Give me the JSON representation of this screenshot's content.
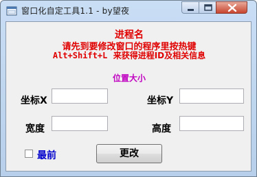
{
  "window": {
    "title": "窗口化自定工具1.1 - by望夜",
    "icon": "app-window-icon"
  },
  "caption_buttons": {
    "minimize": "minimize-icon",
    "maximize": "maximize-icon",
    "close": "close-icon"
  },
  "colors": {
    "info_red": "#e00000",
    "section_magenta": "#c000c0",
    "checkbox_blue": "#0000cc"
  },
  "info": {
    "process_name": "进程名",
    "instruction": "请先到要修改窗口的程序里按热键",
    "hotkey": "Alt+Shift+L",
    "hotkey_desc": "来获得进程ID及相关信息"
  },
  "section_title": "位置大小",
  "fields": {
    "x_label": "坐标X",
    "x_value": "",
    "y_label": "坐标Y",
    "y_value": "",
    "width_label": "宽度",
    "width_value": "",
    "height_label": "高度",
    "height_value": ""
  },
  "topmost": {
    "label": "最前",
    "checked": false
  },
  "change_button": "更改"
}
